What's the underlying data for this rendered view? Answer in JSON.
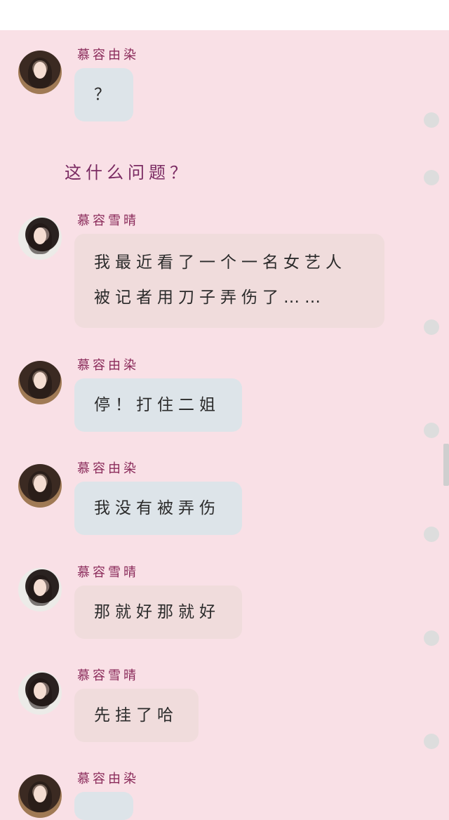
{
  "messages": [
    {
      "sender": "慕容由染",
      "avatar": "avatar-dark",
      "text": [
        "？"
      ]
    },
    {
      "plain": "这什么问题？"
    },
    {
      "sender": "慕容雪晴",
      "avatar": "avatar-light",
      "text": [
        "我最近看了一个一名女艺人",
        "被记者用刀子弄伤了……"
      ]
    },
    {
      "sender": "慕容由染",
      "avatar": "avatar-dark",
      "text": [
        "停！打住二姐"
      ]
    },
    {
      "sender": "慕容由染",
      "avatar": "avatar-dark",
      "text": [
        "我没有被弄伤"
      ]
    },
    {
      "sender": "慕容雪晴",
      "avatar": "avatar-light",
      "text": [
        "那就好那就好"
      ]
    },
    {
      "sender": "慕容雪晴",
      "avatar": "avatar-light",
      "text": [
        "先挂了哈"
      ]
    },
    {
      "sender": "慕容由染",
      "avatar": "avatar-dark",
      "text": []
    }
  ],
  "colors": {
    "background": "#f9e0e6",
    "sender_name": "#8a2a5a",
    "bubble_blue": "#dde4e9",
    "bubble_pink": "#f0dcdc",
    "plain_text": "#7a2a62"
  },
  "icons": {
    "status_dot": "read-status-dot-icon"
  }
}
